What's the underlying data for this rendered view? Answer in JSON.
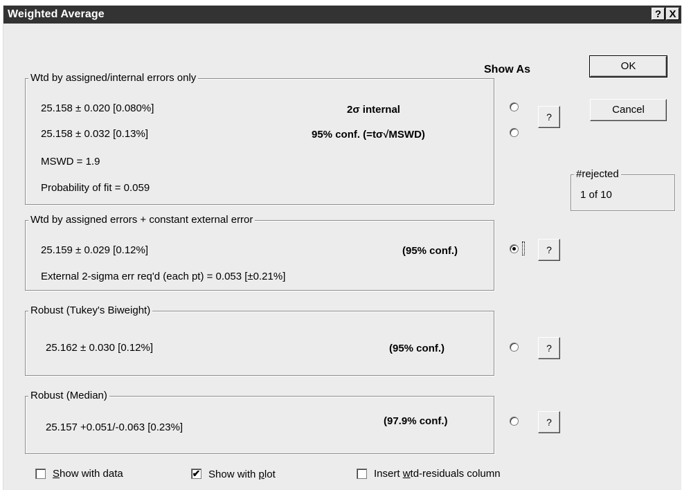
{
  "window": {
    "title": "Weighted Average",
    "help_glyph": "?",
    "close_glyph": "X"
  },
  "show_as_label": "Show As",
  "buttons": {
    "ok": "OK",
    "cancel": "Cancel",
    "help": "?"
  },
  "rejected": {
    "legend": "#rejected",
    "value": "1 of 10"
  },
  "groups": {
    "internal": {
      "legend": "Wtd by assigned/internal errors only",
      "line1": "25.158 ± 0.020  [0.080%]",
      "line2": "25.158 ± 0.032  [0.13%]",
      "mswd": "MSWD = 1.9",
      "prob": "Probability of fit = 0.059",
      "label1": "2σ internal",
      "label2": "95% conf.  (=tσ√MSWD)",
      "radio1_selected": false,
      "radio2_selected": false
    },
    "external": {
      "legend": "Wtd by assigned errors + constant external error",
      "line1": "25.159 ± 0.029  [0.12%]",
      "line2": "External 2-sigma err req'd (each pt) = 0.053  [±0.21%]",
      "label": "(95% conf.)",
      "radio_selected": true
    },
    "tukey": {
      "legend": "Robust (Tukey's Biweight)",
      "line1": "25.162 ± 0.030  [0.12%]",
      "label": "(95% conf.)",
      "radio_selected": false
    },
    "median": {
      "legend": "Robust (Median)",
      "line1": "25.157  +0.051/-0.063  [0.23%]",
      "label": "(97.9% conf.)",
      "radio_selected": false
    }
  },
  "checkboxes": [
    {
      "label_pre": "",
      "label_ul": "S",
      "label_post": "how with data",
      "checked": false
    },
    {
      "label_pre": "Show with ",
      "label_ul": "p",
      "label_post": "lot",
      "checked": true
    },
    {
      "label_pre": "Insert ",
      "label_ul": "w",
      "label_post": "td-residuals column",
      "checked": false
    }
  ],
  "check_glyph": "✔"
}
